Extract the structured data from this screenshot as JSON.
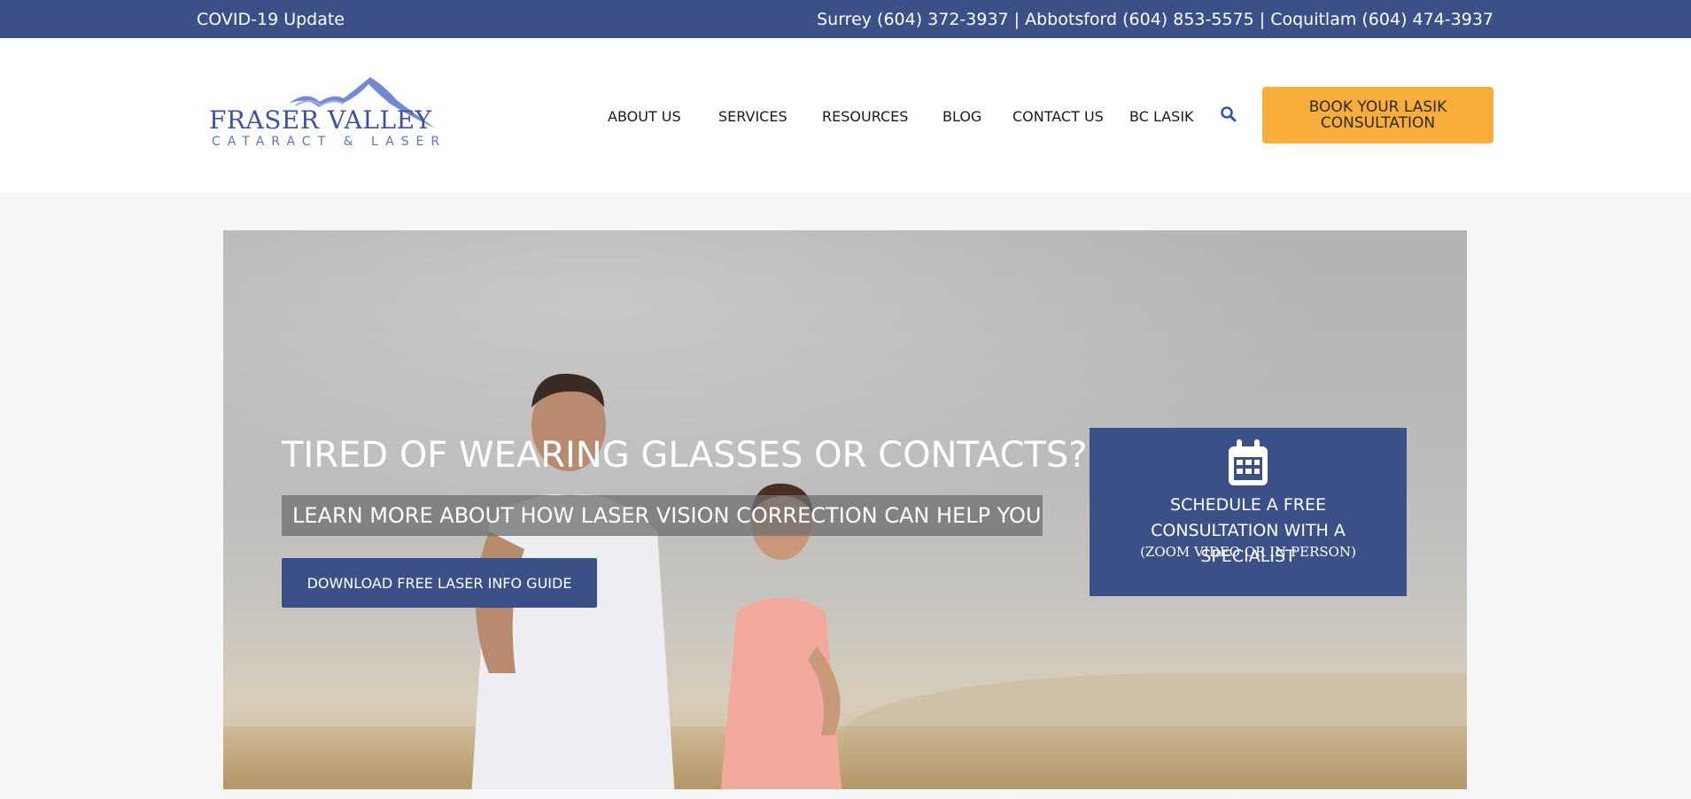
{
  "topbar": {
    "covid_link": "COVID-19 Update",
    "phones": "Surrey (604) 372-3937 | Abbotsford (604) 853-5575 | Coquitlam (604) 474-3937"
  },
  "logo": {
    "line1": "FRASER VALLEY",
    "line2": "CATARACT & LASER"
  },
  "nav": {
    "items": [
      {
        "label": "ABOUT US"
      },
      {
        "label": "SERVICES"
      },
      {
        "label": "RESOURCES"
      },
      {
        "label": "BLOG"
      },
      {
        "label": "CONTACT US"
      },
      {
        "label": "BC LASIK"
      }
    ],
    "search_icon": "search-icon",
    "cta_label": "BOOK YOUR LASIK CONSULTATION"
  },
  "hero": {
    "title": "TIRED OF WEARING GLASSES OR CONTACTS?",
    "subtitle": "LEARN MORE ABOUT HOW LASER VISION CORRECTION CAN HELP YOU",
    "button_label": "DOWNLOAD FREE LASER INFO GUIDE",
    "schedule": {
      "icon": "calendar-icon",
      "line1": "SCHEDULE A FREE CONSULTATION WITH A SPECIALIST",
      "line2": "(ZOOM VIDEO OR IN PERSON)"
    }
  },
  "colors": {
    "brand_blue": "#3a5087",
    "cta_orange": "#f9ae3b"
  }
}
